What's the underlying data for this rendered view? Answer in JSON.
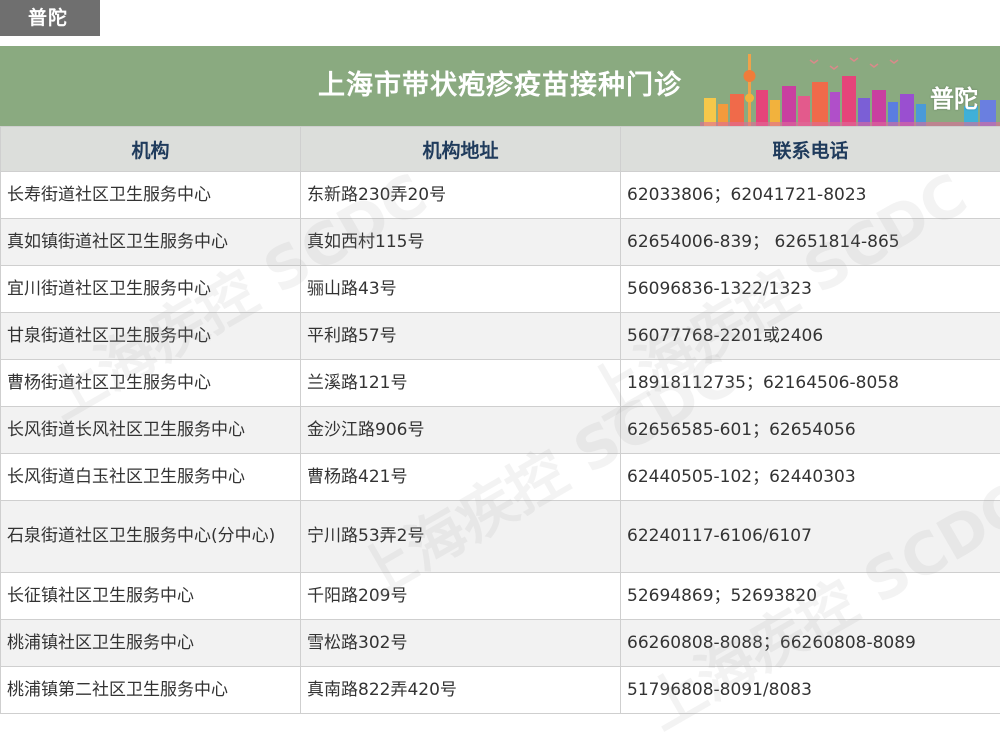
{
  "district_tab": "普陀",
  "banner": {
    "title": "上海市带状疱疹疫苗接种门诊",
    "district": "普陀"
  },
  "colors": {
    "banner_green": "#8aaa80",
    "tab_gray": "#6f6f6f",
    "header_text": "#1f3b5c",
    "header_bg": "#dcdedb"
  },
  "watermark": "上海疾控 SCDC",
  "table": {
    "headers": [
      "机构",
      "机构地址",
      "联系电话"
    ],
    "rows": [
      [
        "长寿街道社区卫生服务中心",
        "东新路230弄20号",
        "62033806；62041721-8023"
      ],
      [
        "真如镇街道社区卫生服务中心",
        "真如西村115号",
        "62654006-839； 62651814-865"
      ],
      [
        "宜川街道社区卫生服务中心",
        "骊山路43号",
        "56096836-1322/1323"
      ],
      [
        "甘泉街道社区卫生服务中心",
        "平利路57号",
        "56077768-2201或2406"
      ],
      [
        "曹杨街道社区卫生服务中心",
        "兰溪路121号",
        "18918112735；62164506-8058"
      ],
      [
        "长风街道长风社区卫生服务中心",
        "金沙江路906号",
        "62656585-601；62654056"
      ],
      [
        "长风街道白玉社区卫生服务中心",
        "曹杨路421号",
        "62440505-102；62440303"
      ],
      [
        "石泉街道社区卫生服务中心(分中心)",
        "宁川路53弄2号",
        "62240117-6106/6107"
      ],
      [
        "长征镇社区卫生服务中心",
        "千阳路209号",
        "52694869；52693820"
      ],
      [
        "桃浦镇社区卫生服务中心",
        "雪松路302号",
        "66260808-8088；66260808-8089"
      ],
      [
        "桃浦镇第二社区卫生服务中心",
        "真南路822弄420号",
        "51796808-8091/8083"
      ]
    ]
  }
}
